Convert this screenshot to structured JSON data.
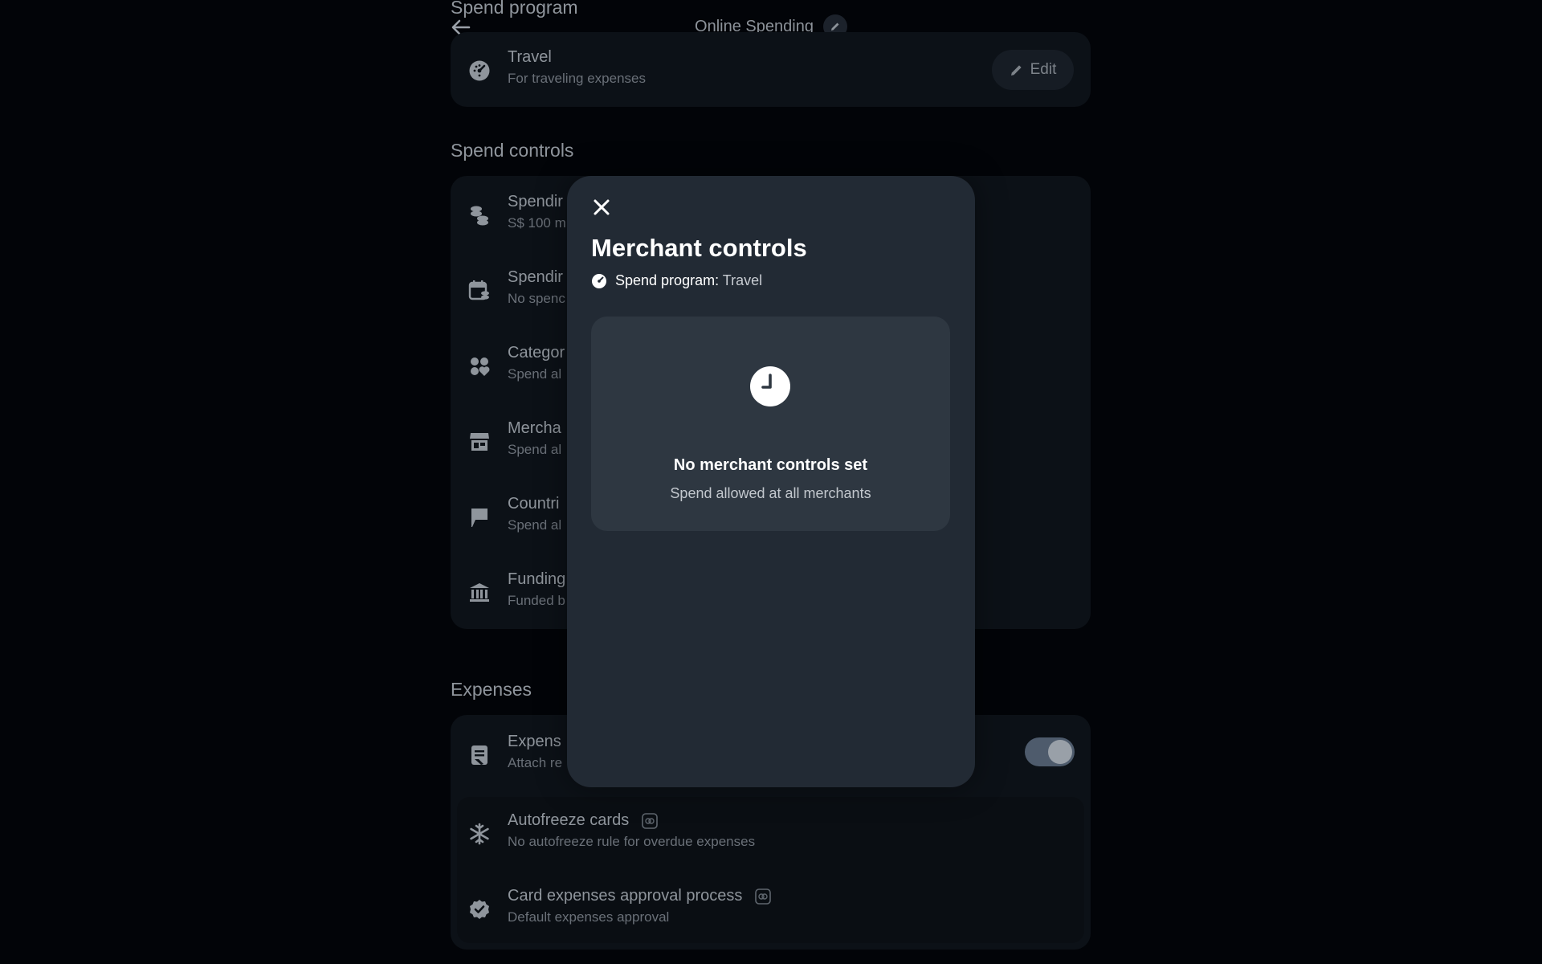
{
  "header": {
    "title": "Online Spending"
  },
  "spend_program_section": {
    "heading": "Spend program",
    "program": {
      "title": "Travel",
      "subtitle": "For traveling expenses",
      "edit_label": "Edit"
    }
  },
  "spend_controls_section": {
    "heading": "Spend controls",
    "items": [
      {
        "title": "Spendir",
        "subtitle": "S$ 100 m",
        "icon": "coins-icon"
      },
      {
        "title": "Spendir",
        "subtitle": "No spenc",
        "icon": "calendar-coins-icon"
      },
      {
        "title": "Categor",
        "subtitle": "Spend al",
        "icon": "categories-icon"
      },
      {
        "title": "Mercha",
        "subtitle": "Spend al",
        "icon": "store-icon"
      },
      {
        "title": "Countri",
        "subtitle": "Spend al",
        "icon": "flag-icon"
      },
      {
        "title": "Funding",
        "subtitle": "Funded b",
        "icon": "bank-icon"
      }
    ]
  },
  "expenses_section": {
    "heading": "Expenses",
    "expense_row": {
      "title": "Expens",
      "subtitle": "Attach re",
      "icon": "receipt-icon",
      "toggle_on": true
    },
    "autofreeze": {
      "title": "Autofreeze cards",
      "subtitle": "No autofreeze rule for overdue expenses",
      "icon": "snowflake-icon"
    },
    "approval": {
      "title": "Card expenses approval process",
      "subtitle": "Default expenses approval",
      "icon": "verified-badge-icon"
    }
  },
  "modal": {
    "title": "Merchant controls",
    "program_label": "Spend program:",
    "program_value": "Travel",
    "empty_title": "No merchant controls set",
    "empty_subtitle": "Spend allowed at all merchants"
  }
}
